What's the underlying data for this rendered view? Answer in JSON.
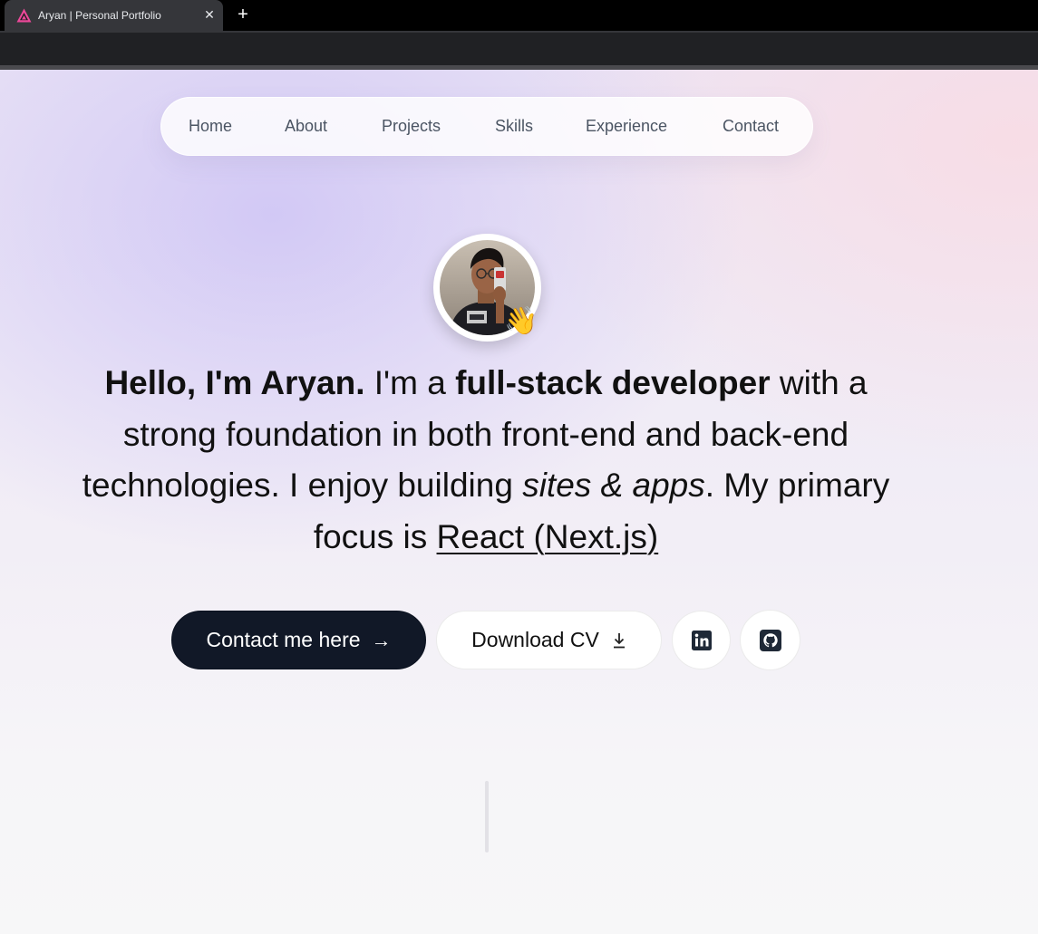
{
  "browser": {
    "tab_title": "Aryan | Personal Portfolio",
    "close_glyph": "✕",
    "new_tab_glyph": "+"
  },
  "nav": {
    "items": [
      {
        "label": "Home"
      },
      {
        "label": "About"
      },
      {
        "label": "Projects"
      },
      {
        "label": "Skills"
      },
      {
        "label": "Experience"
      },
      {
        "label": "Contact"
      }
    ]
  },
  "hero": {
    "greeting": "Hello, I'm Aryan.",
    "text1": " I'm a ",
    "role": "full-stack developer",
    "text2": " with a strong foundation in both front-end and back-end technologies. I enjoy building ",
    "focus_italic": "sites & apps",
    "text3": ". My primary focus is ",
    "focus_link": "React (Next.js)",
    "wave_emoji": "👋"
  },
  "actions": {
    "contact_label": "Contact me here",
    "contact_arrow": "→",
    "cv_label": "Download CV",
    "linkedin_icon": "linkedin-icon",
    "github_icon": "github-icon"
  },
  "colors": {
    "primary_button": "#111827",
    "favicon": "#ec4899"
  }
}
